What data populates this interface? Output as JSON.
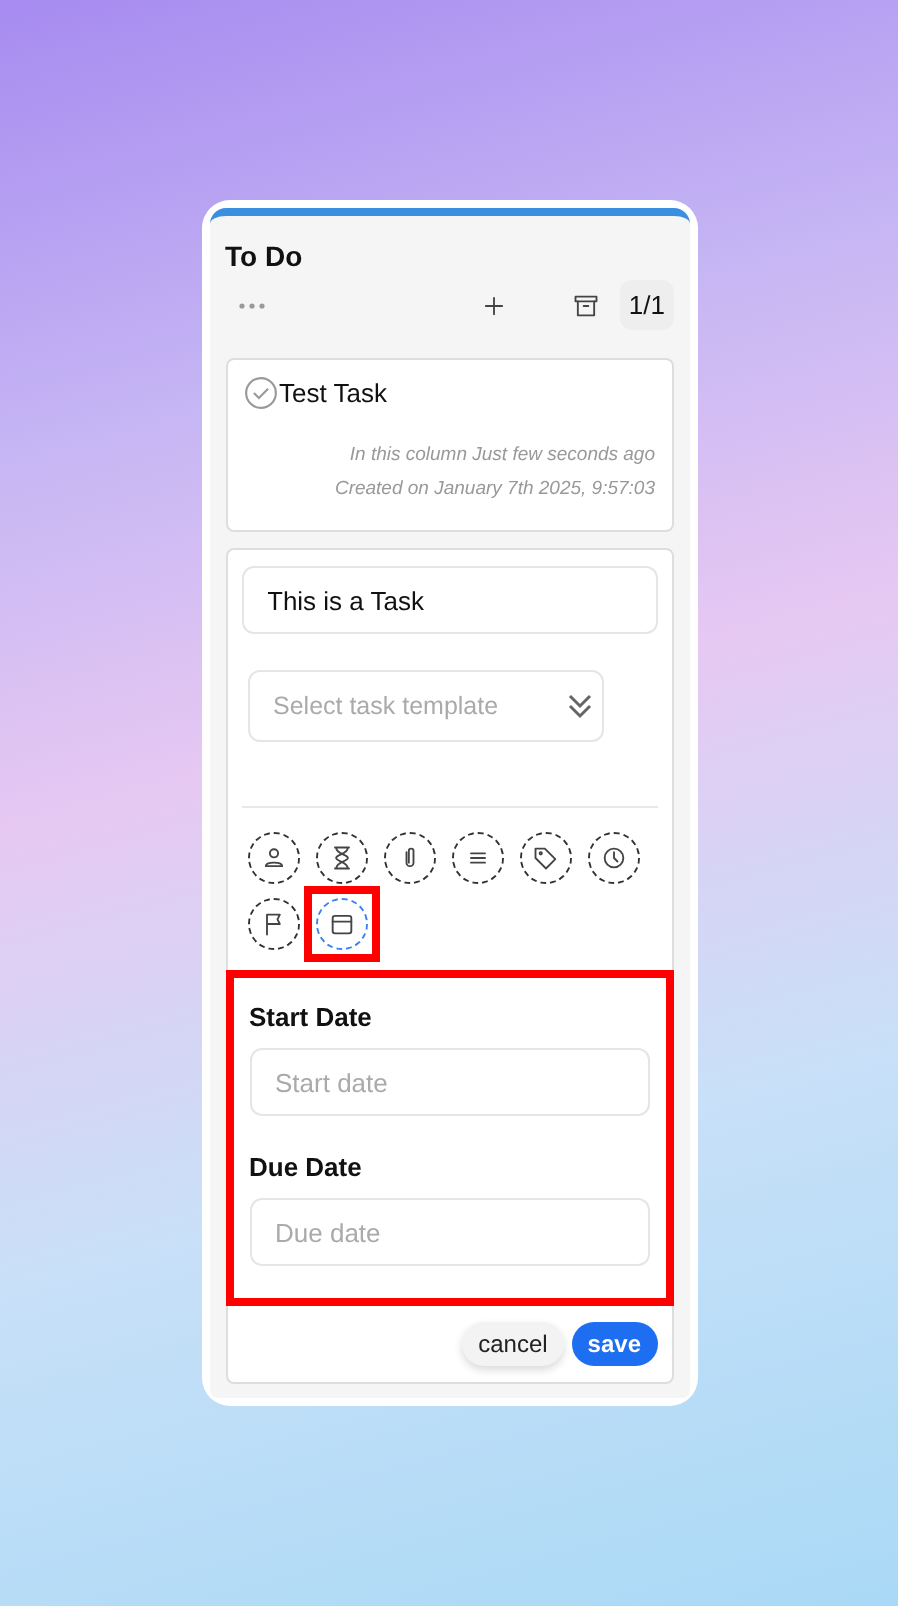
{
  "column": {
    "title": "To Do",
    "count": "1/1"
  },
  "card": {
    "title": "Test Task",
    "completed": false,
    "meta": [
      "In this column Just few seconds ago",
      "Created on January 7th 2025, 9:57:03"
    ]
  },
  "form": {
    "name_value": "This is a Task",
    "template": {
      "placeholder": "Select task template"
    },
    "properties": [
      {
        "kind": "assignee",
        "selected": false,
        "highlighted": false
      },
      {
        "kind": "estimate",
        "selected": false,
        "highlighted": false
      },
      {
        "kind": "attachment",
        "selected": false,
        "highlighted": false
      },
      {
        "kind": "description",
        "selected": false,
        "highlighted": false
      },
      {
        "kind": "tags",
        "selected": false,
        "highlighted": false
      },
      {
        "kind": "time",
        "selected": false,
        "highlighted": false
      },
      {
        "kind": "priority",
        "selected": false,
        "highlighted": false
      },
      {
        "kind": "dates",
        "selected": true,
        "highlighted": true
      }
    ],
    "dates": {
      "highlighted": true,
      "fields": [
        {
          "label": "Start Date",
          "placeholder": "Start date"
        },
        {
          "label": "Due Date",
          "placeholder": "Due date"
        }
      ]
    },
    "buttons": [
      {
        "kind": "secondary",
        "label": "cancel"
      },
      {
        "kind": "primary",
        "label": "save"
      }
    ]
  }
}
